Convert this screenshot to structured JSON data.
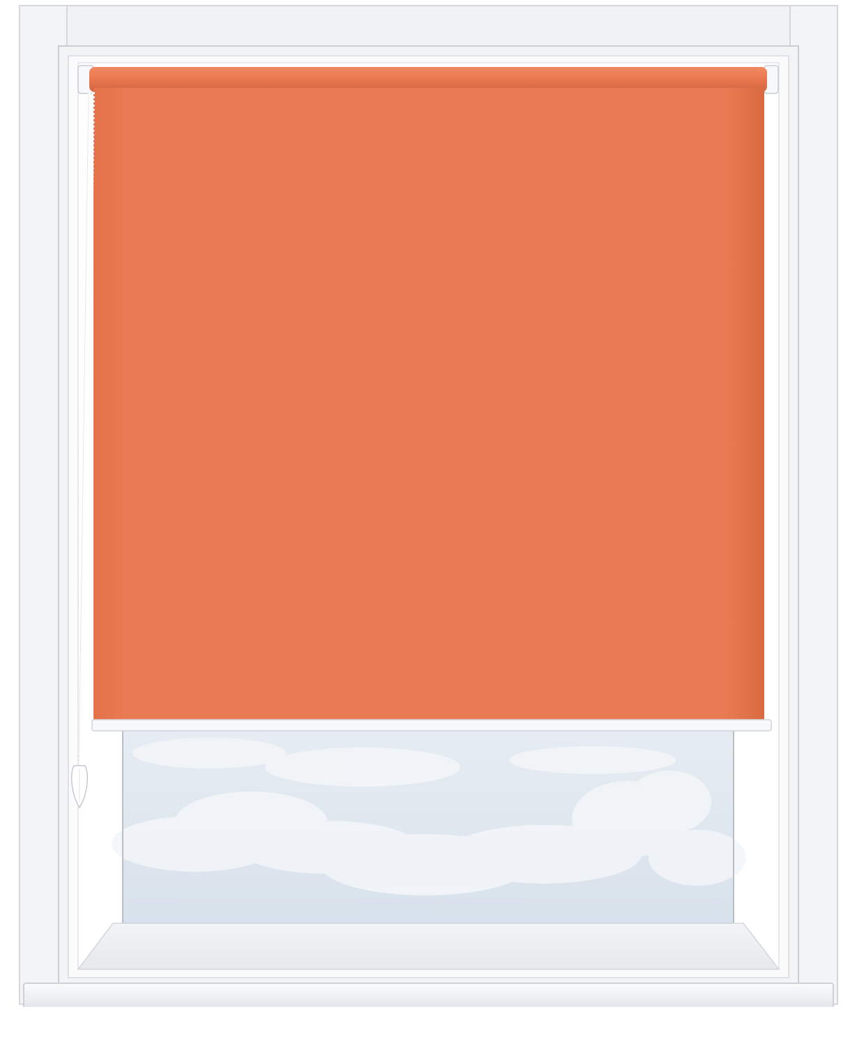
{
  "scene": {
    "subject": "roller-blind-in-window",
    "colors": {
      "frame": "#f4f5f7",
      "frame_shade": "#e4e6ea",
      "frame_edge": "#cfd3d9",
      "blind_fabric": "#ea7c55",
      "blind_fabric_dark": "#d9693f",
      "bottom_rail": "#f7f8f9",
      "chain": "#ffffff",
      "sky_top": "#e6ecf2",
      "sky_bottom": "#d8e2ec",
      "cloud": "#f3f6f9"
    },
    "icons": {
      "chain_handle": "chain-weight-icon"
    }
  }
}
